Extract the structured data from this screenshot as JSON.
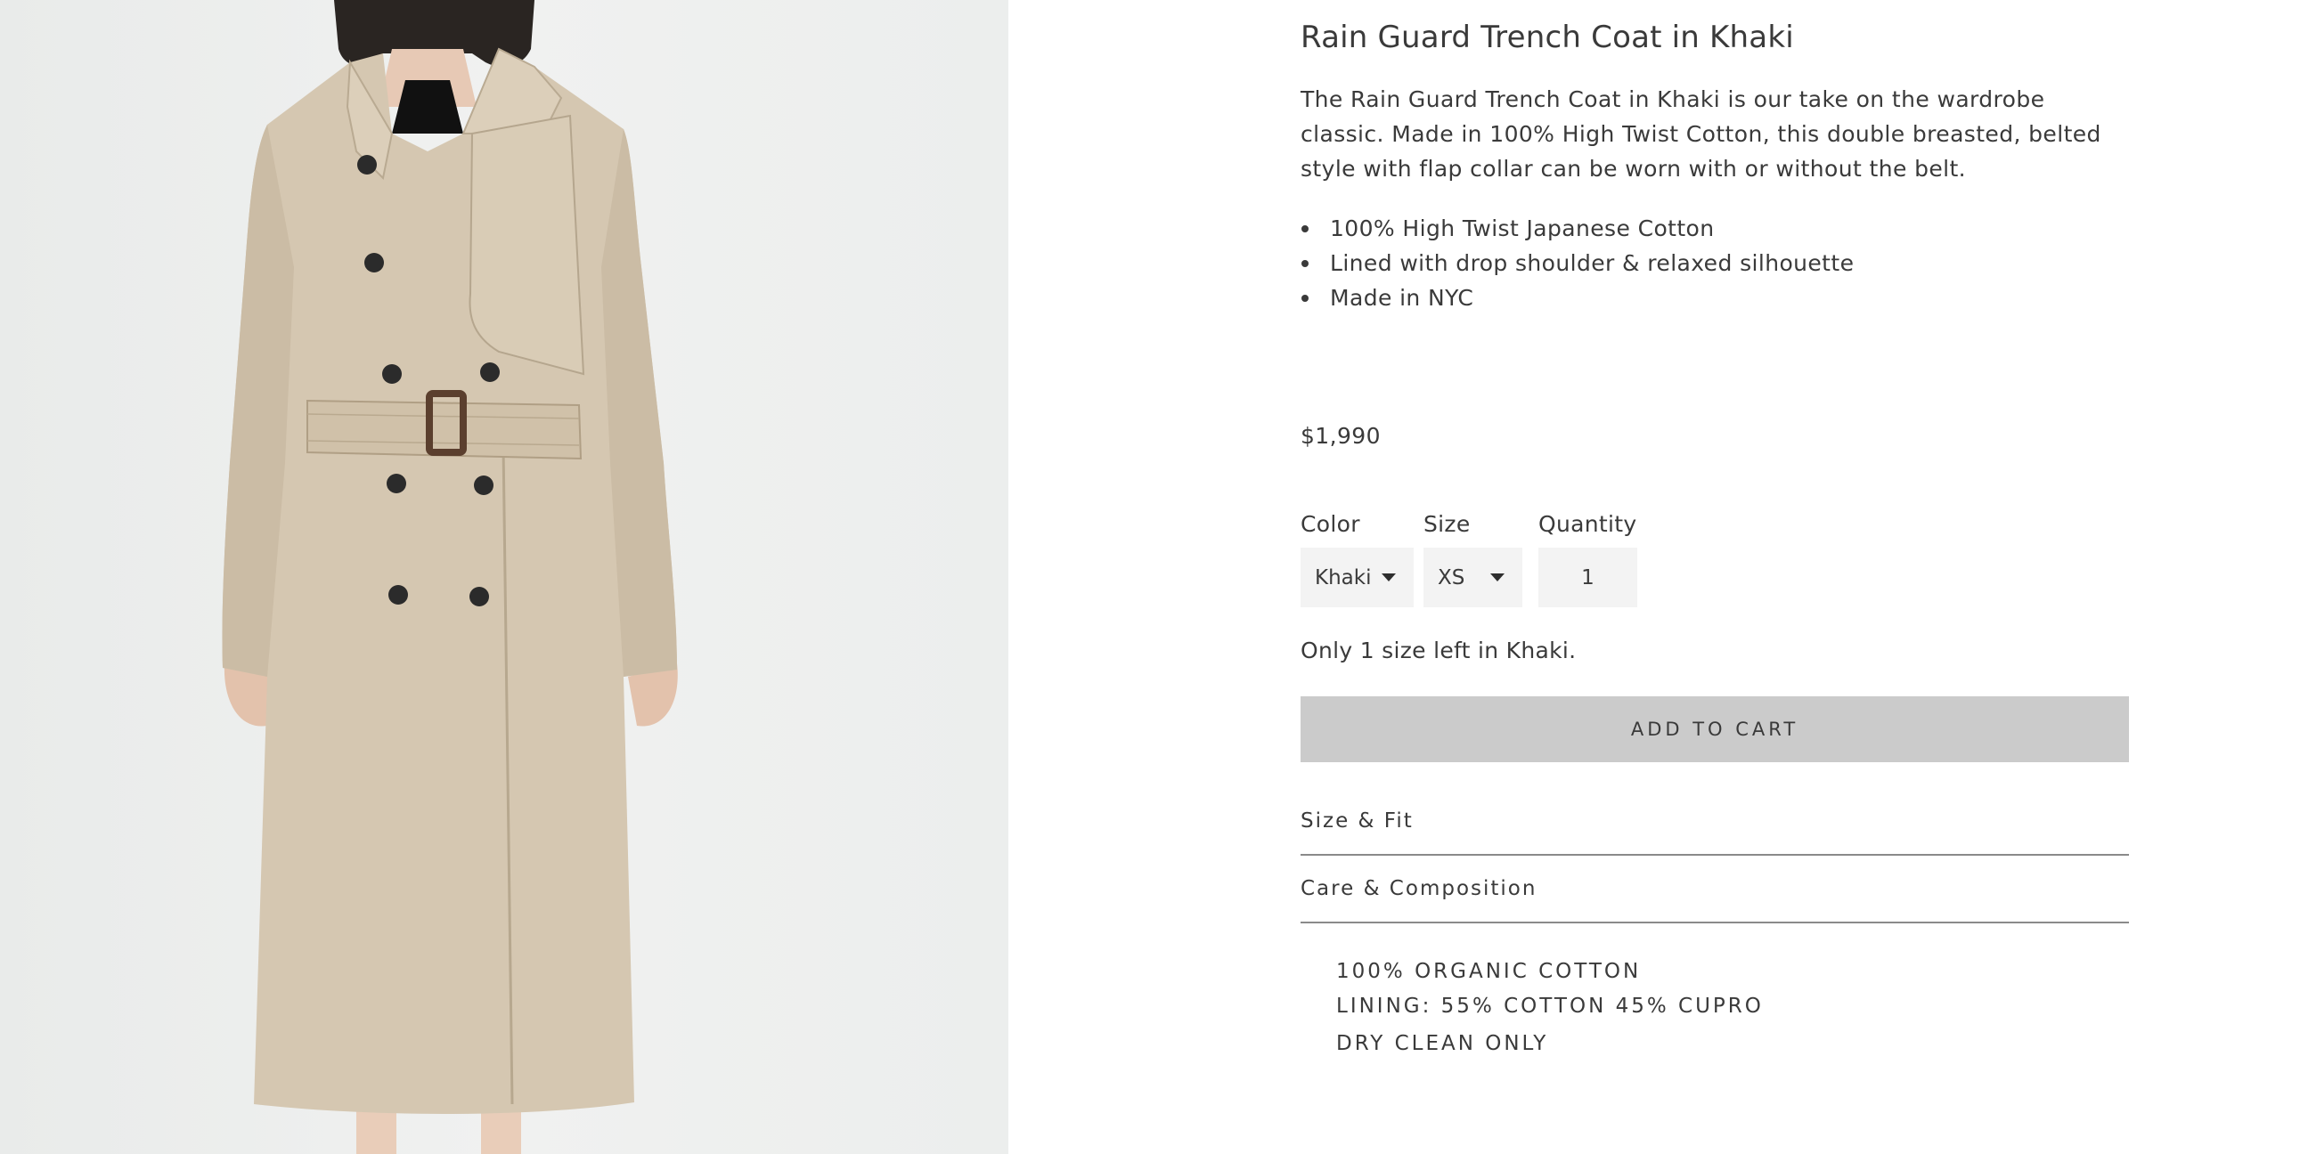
{
  "product": {
    "title": "Rain Guard Trench Coat in Khaki",
    "image_alt": "Model wearing the Rain Guard Trench Coat in Khaki",
    "description": "The Rain Guard Trench Coat in Khaki is our take on the wardrobe classic. Made in 100% High Twist Cotton, this double breasted, belted style with flap collar can be worn with or without the belt.",
    "features": [
      "100% High Twist Japanese Cotton",
      "Lined with drop shoulder & relaxed silhouette",
      "Made in NYC"
    ],
    "price": "$1,990"
  },
  "options": {
    "color": {
      "label": "Color",
      "value": "Khaki"
    },
    "size": {
      "label": "Size",
      "value": "XS"
    },
    "quantity": {
      "label": "Quantity",
      "value": "1"
    }
  },
  "stock_note": "Only 1 size left in Khaki.",
  "add_to_cart_label": "ADD TO CART",
  "accordion": {
    "size_fit_label": "Size & Fit",
    "care_label": "Care & Composition",
    "care_items": [
      "100% ORGANIC COTTON",
      "LINING: 55% COTTON 45% CUPRO",
      "DRY CLEAN ONLY"
    ]
  },
  "colors": {
    "coat": "#d5c7b1",
    "background": "#eeefee",
    "button": "#cbcbcb",
    "select_bg": "#f3f3f3",
    "text": "#3a3a3a"
  }
}
